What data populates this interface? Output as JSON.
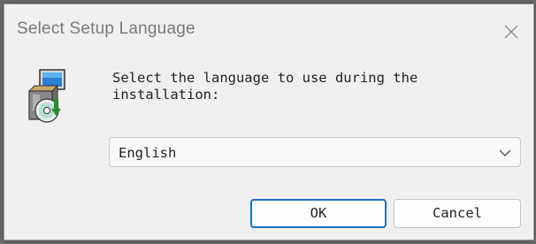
{
  "window": {
    "title": "Select Setup Language",
    "close_icon": "close-icon"
  },
  "content": {
    "icon": "setup-installer-icon",
    "prompt": "Select the language to use during the\ninstallation:",
    "language_select": {
      "value": "English",
      "chevron_icon": "chevron-down-icon"
    }
  },
  "buttons": {
    "ok_label": "OK",
    "cancel_label": "Cancel"
  },
  "colors": {
    "background": "#f0f0f0",
    "accent": "#1f6fbf"
  }
}
